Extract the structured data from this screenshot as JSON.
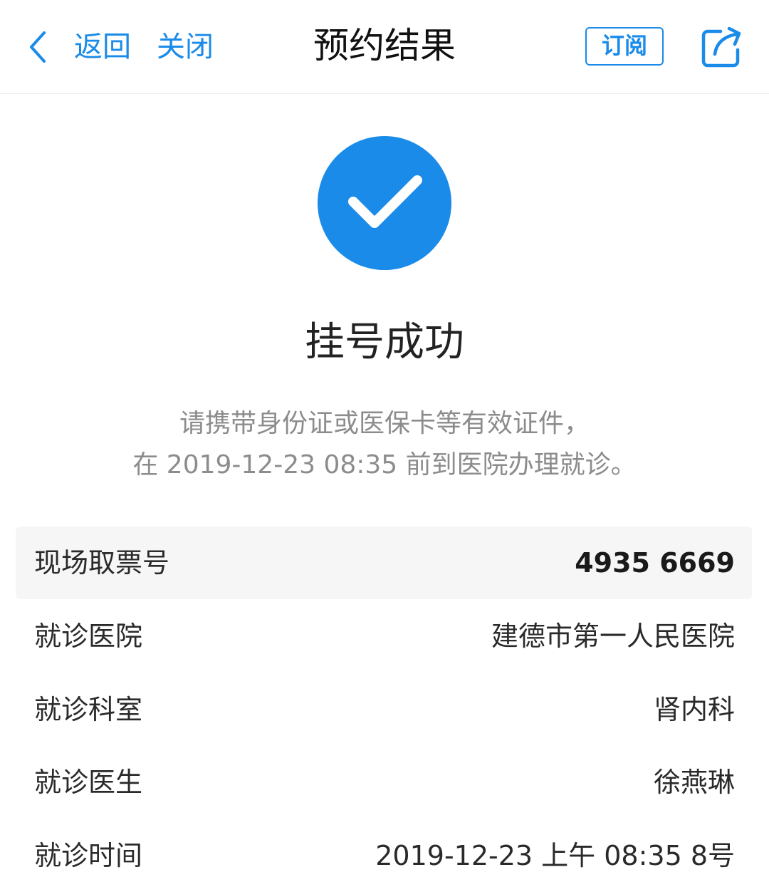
{
  "header": {
    "back_label": "返回",
    "close_label": "关闭",
    "title": "预约结果",
    "subscribe_label": "订阅"
  },
  "result": {
    "status": "挂号成功",
    "hint_line1": "请携带身份证或医保卡等有效证件，",
    "hint_line2": "在 2019-12-23 08:35 前到医院办理就诊。"
  },
  "details": [
    {
      "label": "现场取票号",
      "value": "4935 6669"
    },
    {
      "label": "就诊医院",
      "value": "建德市第一人民医院"
    },
    {
      "label": "就诊科室",
      "value": "肾内科"
    },
    {
      "label": "就诊医生",
      "value": "徐燕琳"
    },
    {
      "label": "就诊时间",
      "value": "2019-12-23 上午 08:35 8号"
    }
  ],
  "colors": {
    "accent": "#1a8be8",
    "hint_text": "#8c8c8c",
    "highlight_row_bg": "#f6f6f6"
  },
  "icons": {
    "back": "chevron-left-icon",
    "share": "share-icon",
    "success": "checkmark-circle-icon"
  }
}
